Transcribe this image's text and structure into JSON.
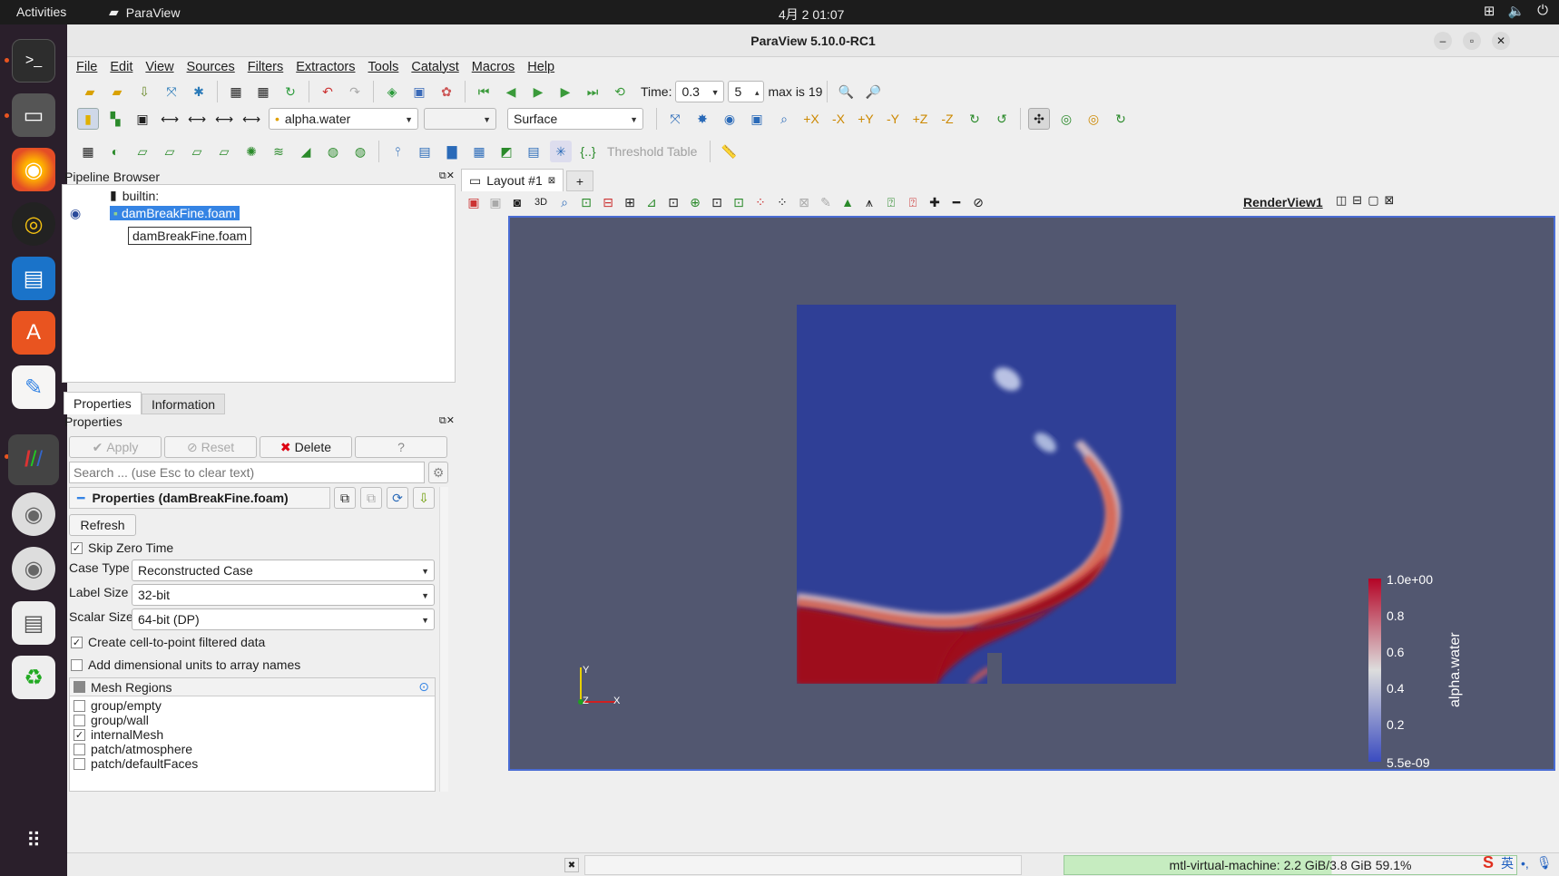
{
  "topbar": {
    "activities": "Activities",
    "app": "ParaView",
    "clock": "4月 2  01:07"
  },
  "window": {
    "title": "ParaView 5.10.0-RC1"
  },
  "menu": [
    "File",
    "Edit",
    "View",
    "Sources",
    "Filters",
    "Extractors",
    "Tools",
    "Catalyst",
    "Macros",
    "Help"
  ],
  "toolbar": {
    "time_label": "Time:",
    "time_value": "0.3",
    "step_value": "5",
    "max_label": "max is 19",
    "array_value": "alpha.water",
    "repr_value": "Surface",
    "threshold_table": "Threshold Table"
  },
  "pipeline": {
    "header": "Pipeline Browser",
    "builtin": "builtin:",
    "item": "damBreakFine.foam",
    "tooltip": "damBreakFine.foam"
  },
  "tabs": {
    "properties": "Properties",
    "information": "Information"
  },
  "properties": {
    "header": "Properties",
    "apply": "Apply",
    "reset": "Reset",
    "delete": "Delete",
    "help": "?",
    "search_placeholder": "Search ... (use Esc to clear text)",
    "section": "Properties (damBreakFine.foam)",
    "refresh": "Refresh",
    "skip_zero": "Skip Zero Time",
    "case_type_label": "Case Type",
    "case_type": "Reconstructed Case",
    "label_size_label": "Label Size",
    "label_size": "32-bit",
    "scalar_size_label": "Scalar Size",
    "scalar_size": "64-bit (DP)",
    "create_cell": "Create cell-to-point filtered data",
    "add_units": "Add dimensional units to array names",
    "mesh_regions": "Mesh Regions",
    "regions": [
      {
        "name": "group/empty",
        "checked": false
      },
      {
        "name": "group/wall",
        "checked": false
      },
      {
        "name": "internalMesh",
        "checked": true
      },
      {
        "name": "patch/atmosphere",
        "checked": false
      },
      {
        "name": "patch/defaultFaces",
        "checked": false
      }
    ]
  },
  "layout": {
    "tab": "Layout #1",
    "plus": "+",
    "view": "RenderView1",
    "btn3d": "3D"
  },
  "colorbar": {
    "title": "alpha.water",
    "ticks": [
      "1.0e+00",
      "0.8",
      "0.6",
      "0.4",
      "0.2",
      "5.5e-09"
    ]
  },
  "axes": {
    "y": "Y",
    "z": "Z",
    "x": "X"
  },
  "status": {
    "memory": "mtl-virtual-machine: 2.2 GiB/3.8 GiB 59.1%",
    "ime": "英"
  },
  "colors": {
    "accent": "#3584e4",
    "water": "#9e0c1a",
    "domain": "#2f3f96",
    "background": "#525770"
  }
}
